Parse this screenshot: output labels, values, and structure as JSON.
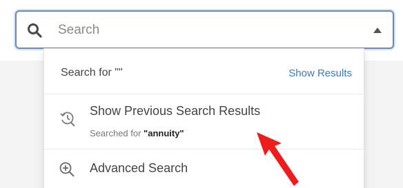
{
  "search": {
    "placeholder": "Search",
    "value": ""
  },
  "dropdown": {
    "search_for_prefix": "Search for \"\"",
    "show_results": "Show Results",
    "previous": {
      "title": "Show Previous Search Results",
      "sub_prefix": "Searched for ",
      "term": "\"annuity\""
    },
    "advanced": "Advanced Search"
  },
  "icons": {
    "search": "search-icon",
    "caret": "caret-up-icon",
    "history": "history-search-icon",
    "advanced": "zoom-in-icon"
  },
  "colors": {
    "accent": "#3a7bbf",
    "focus_border": "#6b8ab4",
    "annotation": "#ee1c1c"
  }
}
